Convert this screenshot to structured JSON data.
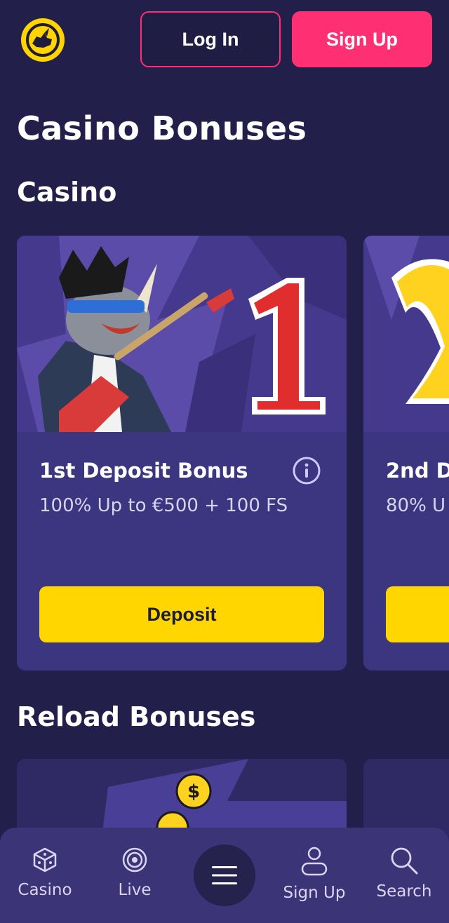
{
  "header": {
    "logo_icon": "rhino-logo-icon",
    "login_label": "Log In",
    "signup_label": "Sign Up"
  },
  "page": {
    "title": "Casino Bonuses"
  },
  "sections": {
    "casino": {
      "title": "Casino",
      "cards": [
        {
          "art": "rhino-guitar-number-1",
          "title": "1st Deposit Bonus",
          "subtitle": "100% Up to €500 + 100 FS",
          "button_label": "Deposit",
          "info_icon": "info-icon"
        },
        {
          "art": "number-2",
          "title": "2nd D",
          "subtitle": "80% U",
          "button_label": "",
          "info_icon": ""
        }
      ]
    },
    "reload": {
      "title": "Reload Bonuses"
    }
  },
  "bottom_nav": {
    "items": [
      {
        "label": "Casino",
        "icon": "dice-icon"
      },
      {
        "label": "Live",
        "icon": "live-icon"
      },
      {
        "label": "",
        "icon": "hamburger-menu-icon"
      },
      {
        "label": "Sign Up",
        "icon": "user-icon"
      },
      {
        "label": "Search",
        "icon": "search-icon"
      }
    ]
  },
  "colors": {
    "background": "#22204a",
    "card": "#3c3580",
    "accent_pink": "#ff2f74",
    "accent_yellow": "#ffd600",
    "nav": "#3b3477"
  }
}
